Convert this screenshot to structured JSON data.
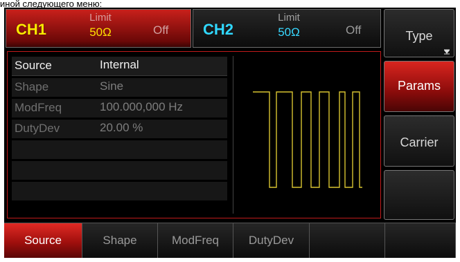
{
  "caption": "иной следующего меню:",
  "channels": [
    {
      "name": "CH1",
      "limit_label": "Limit",
      "impedance": "50Ω",
      "state": "Off"
    },
    {
      "name": "CH2",
      "limit_label": "Limit",
      "impedance": "50Ω",
      "state": "Off"
    }
  ],
  "params": [
    {
      "label": "Source",
      "value": "Internal"
    },
    {
      "label": "Shape",
      "value": "Sine"
    },
    {
      "label": "ModFreq",
      "value": "100.000,000 Hz"
    },
    {
      "label": "DutyDev",
      "value": "20.00 %"
    },
    {
      "label": "",
      "value": ""
    },
    {
      "label": "",
      "value": ""
    },
    {
      "label": "",
      "value": ""
    }
  ],
  "softkeys": [
    "Type",
    "Params",
    "Carrier",
    ""
  ],
  "bottom_tabs": [
    "Source",
    "Shape",
    "ModFreq",
    "DutyDev",
    "",
    ""
  ],
  "colors": {
    "ch1_accent": "#ffe000",
    "ch2_accent": "#38d8ff",
    "active_red": "#c8201b",
    "waveform": "#d8c430"
  }
}
